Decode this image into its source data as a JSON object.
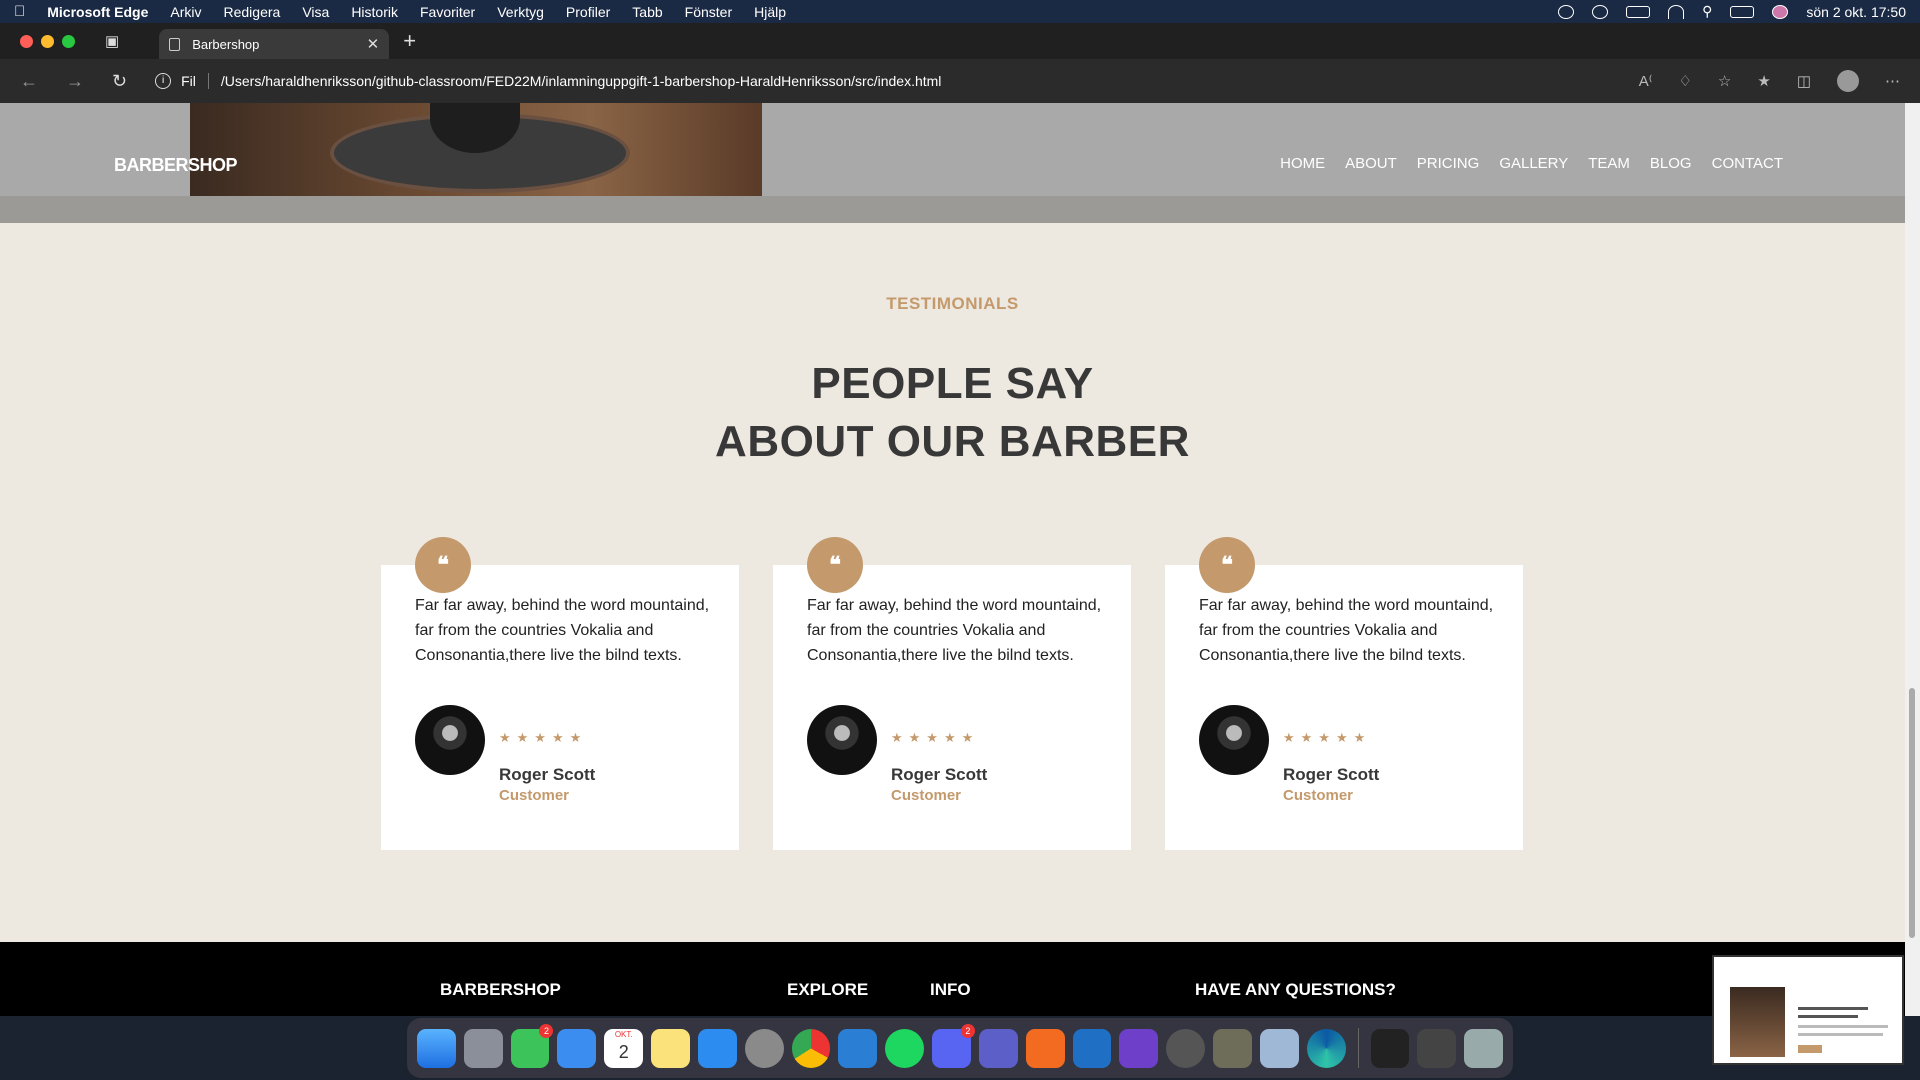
{
  "menubar": {
    "app": "Microsoft Edge",
    "items": [
      "Arkiv",
      "Redigera",
      "Visa",
      "Historik",
      "Favoriter",
      "Verktyg",
      "Profiler",
      "Tabb",
      "Fönster",
      "Hjälp"
    ],
    "datetime": "sön 2 okt. 17:50"
  },
  "browser": {
    "tab_title": "Barbershop",
    "address_prefix": "Fil",
    "url": "/Users/haraldhenriksson/github-classroom/FED22M/inlamninguppgift-1-barbershop-HaraldHenriksson/src/index.html"
  },
  "site": {
    "brand": "BARBERSHOP",
    "nav": [
      "HOME",
      "ABOUT",
      "PRICING",
      "GALLERY",
      "TEAM",
      "BLOG",
      "CONTACT"
    ],
    "eyebrow": "TESTIMONIALS",
    "heading_line1": "PEOPLE SAY",
    "heading_line2": "ABOUT OUR BARBER",
    "testimonials": [
      {
        "quote_mark": "❝",
        "text": "Far far away, behind the word mountaind, far from the countries Vokalia and Consonantia,there live the bilnd texts.",
        "stars": "★★★★★",
        "name": "Roger Scott",
        "role": "Customer"
      },
      {
        "quote_mark": "❝",
        "text": "Far far away, behind the word mountaind, far from the countries Vokalia and Consonantia,there live the bilnd texts.",
        "stars": "★★★★★",
        "name": "Roger Scott",
        "role": "Customer"
      },
      {
        "quote_mark": "❝",
        "text": "Far far away, behind the word mountaind, far from the countries Vokalia and Consonantia,there live the bilnd texts.",
        "stars": "★★★★★",
        "name": "Roger Scott",
        "role": "Customer"
      }
    ],
    "footer": {
      "brand": "BARBERSHOP",
      "explore": "EXPLORE",
      "info": "INFO",
      "questions": "HAVE ANY QUESTIONS?"
    }
  },
  "dock": {
    "messages_badge": "2",
    "calendar_month": "OKT.",
    "calendar_day": "2",
    "discord_badge": "2"
  },
  "colors": {
    "accent": "#c49a6c",
    "page_bg": "#ede8e0",
    "heading": "#383838"
  }
}
